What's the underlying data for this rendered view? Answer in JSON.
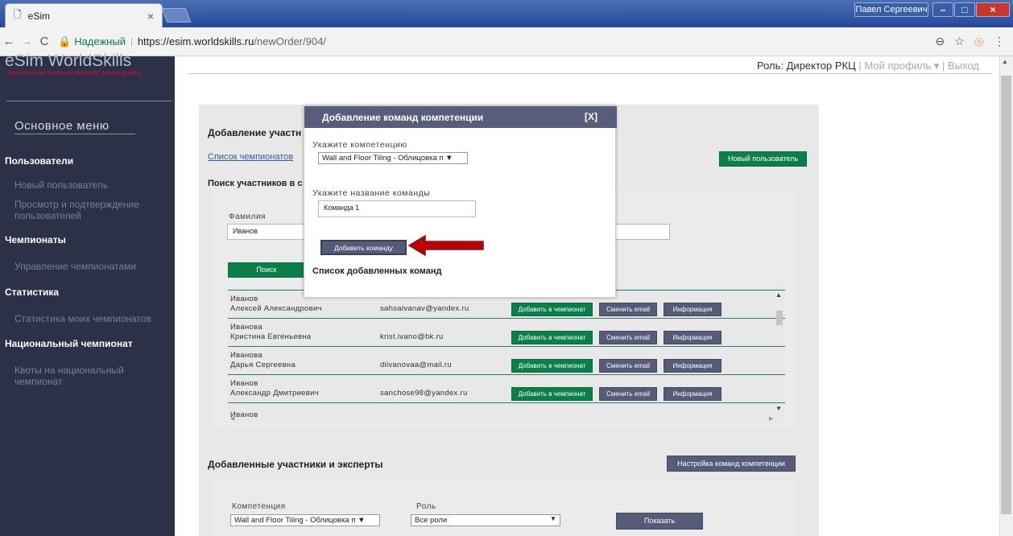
{
  "browser": {
    "tab_title": "eSim",
    "tab_close": "×",
    "window_user": "Павел Сергеевич",
    "secure_label": "Надежный",
    "url_host": "https://esim.worldskills.ru",
    "url_path": "/newOrder/904/"
  },
  "sidebar": {
    "logo": "eSim WorldSkills",
    "logo_sub": "Электронная система интернет мониторинга",
    "main_menu": "Основное меню",
    "sections": [
      {
        "title": "Пользователи",
        "items": [
          "Новый пользователь",
          "Просмотр и подтверждение пользователей"
        ]
      },
      {
        "title": "Чемпионаты",
        "items": [
          "Управление чемпионатами"
        ]
      },
      {
        "title": "Статистика",
        "items": [
          "Статистика моих чемпионатов"
        ]
      },
      {
        "title": "Национальный чемпионат",
        "items": [
          "Квоты на национальный чемпионат"
        ]
      }
    ]
  },
  "header": {
    "role": "Роль: Директор РКЦ",
    "profile": "Мой профиль ▾",
    "sep": "|",
    "exit": "Выход"
  },
  "main": {
    "title_partial": "Добавление участн",
    "champ_list_link": "Список чемпионатов",
    "new_user_button": "Новый пользователь",
    "search_title_partial": "Поиск участников в с",
    "surname_label": "Фамилия",
    "surname_value": "Иванов",
    "search_button": "Поиск",
    "results": [
      {
        "surname": "Иванов",
        "name": "Алексей Александрович",
        "email": "sahsaivanav@yandex.ru"
      },
      {
        "surname": "Иванова",
        "name": "Кристина Евгеньевна",
        "email": "krist.ivano@bk.ru"
      },
      {
        "surname": "Иванова",
        "name": "Дарья Сергеевна",
        "email": "diivanovaa@mail.ru"
      },
      {
        "surname": "Иванов",
        "name": "Александр Дмитриевич",
        "email": "sanchose98@yandex.ru"
      },
      {
        "surname": "Иванов",
        "name": "",
        "email": ""
      }
    ],
    "row_buttons": {
      "add": "Добавить в чемпионат",
      "change_email": "Сменить email",
      "info": "Информация"
    },
    "added_title": "Добавленные участники и эксперты",
    "team_settings_button": "Настройка команд компетенции",
    "competence_label": "Компетенция",
    "competence_value": "Wall and Floor Tiling - Облицовка п ▼",
    "role_label": "Роль",
    "role_value": "Все роли",
    "show_button": "Показать"
  },
  "dialog": {
    "title": "Добавление команд компетенции",
    "close": "[X]",
    "competence_label": "Укажите компетенцию",
    "competence_value": "Wall and Floor Tiling - Облицовка п ▼",
    "team_label": "Укажите название команды",
    "team_value": "Команда 1",
    "add_button": "Добавить команду",
    "added_list_title": "Список добавленных команд"
  },
  "colors": {
    "accent_green": "#0a7f4a",
    "dialog_header": "#585d7c",
    "sidebar": "#2c3147",
    "arrow": "#c00000"
  }
}
